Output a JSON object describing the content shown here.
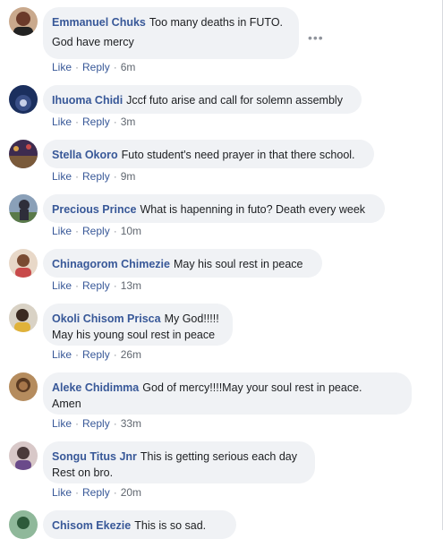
{
  "comments": [
    {
      "author": "Emmanuel Chuks",
      "lines": [
        "Too many deaths in FUTO.",
        "God have mercy"
      ],
      "like": "Like",
      "reply": "Reply",
      "time": "6m",
      "avatar_color": "#6b3a2a",
      "avatar_bg": "#c9a98d"
    },
    {
      "author": "Ihuoma Chidi",
      "lines": [
        "Jccf futo arise and call for solemn assembly"
      ],
      "like": "Like",
      "reply": "Reply",
      "time": "3m",
      "avatar_color": "#1b2f5e",
      "avatar_bg": "#3a4f87"
    },
    {
      "author": "Stella Okoro",
      "lines": [
        "Futo student's need prayer in that there school."
      ],
      "like": "Like",
      "reply": "Reply",
      "time": "9m",
      "avatar_color": "#3d2b4f",
      "avatar_bg": "#7a5a3a"
    },
    {
      "author": "Precious Prince",
      "lines": [
        "What is hapenning in futo? Death every week"
      ],
      "like": "Like",
      "reply": "Reply",
      "time": "10m",
      "avatar_color": "#2e2e3a",
      "avatar_bg": "#8aa0b8"
    },
    {
      "author": "Chinagorom Chimezie",
      "lines": [
        "May his soul rest in peace"
      ],
      "like": "Like",
      "reply": "Reply",
      "time": "13m",
      "avatar_color": "#7a4b32",
      "avatar_bg": "#e8d8c8"
    },
    {
      "author": "Okoli Chisom Prisca",
      "lines": [
        "My God!!!!!",
        "May his young soul rest in peace"
      ],
      "like": "Like",
      "reply": "Reply",
      "time": "26m",
      "avatar_color": "#3b2a20",
      "avatar_bg": "#d9d2c5"
    },
    {
      "author": "Aleke Chidimma",
      "lines": [
        "God of mercy!!!!May your soul rest in peace.",
        "Amen"
      ],
      "like": "Like",
      "reply": "Reply",
      "time": "33m",
      "avatar_color": "#5a3a22",
      "avatar_bg": "#b58c5e"
    },
    {
      "author": "Songu Titus Jnr",
      "lines": [
        "This is getting serious each day",
        "Rest on bro."
      ],
      "like": "Like",
      "reply": "Reply",
      "time": "20m",
      "avatar_color": "#4a3a3a",
      "avatar_bg": "#d8c8c8"
    },
    {
      "author": "Chisom Ekezie",
      "lines": [
        "This is so sad."
      ],
      "like": "",
      "reply": "",
      "time": "",
      "avatar_color": "#2d5a3a",
      "avatar_bg": "#8fb89a"
    }
  ],
  "more_icon": "more-options-icon",
  "colors": {
    "author": "#385898",
    "bubble": "#f0f2f5",
    "meta": "#606770"
  }
}
